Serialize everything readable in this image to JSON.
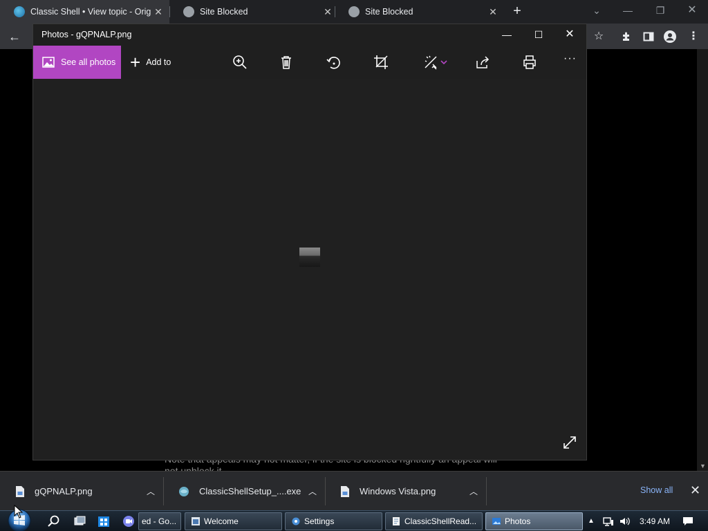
{
  "browser": {
    "tabs": [
      {
        "title": "Classic Shell • View topic - Origin",
        "active": true
      },
      {
        "title": "Site Blocked",
        "active": false
      },
      {
        "title": "Site Blocked",
        "active": false
      }
    ],
    "new_tab": "+",
    "close_glyph": "✕"
  },
  "page": {
    "partial_text": "Note that appeals may not matter, if the site is blocked rightfully an appeal will not unblock it."
  },
  "photos": {
    "title": "Photos - gQPNALP.png",
    "see_all_label": "See all photos",
    "add_to_label": "Add to",
    "more_label": "···",
    "accent": "#b146c2"
  },
  "downloads": {
    "items": [
      {
        "name": "gQPNALP.png"
      },
      {
        "name": "ClassicShellSetup_....exe"
      },
      {
        "name": "Windows Vista.png"
      }
    ],
    "show_all": "Show all"
  },
  "taskbar": {
    "buttons": [
      {
        "label": "ed - Go..."
      },
      {
        "label": "Welcome"
      },
      {
        "label": "Settings"
      },
      {
        "label": "ClassicShellRead..."
      },
      {
        "label": "Photos"
      }
    ],
    "clock": "3:49 AM"
  }
}
